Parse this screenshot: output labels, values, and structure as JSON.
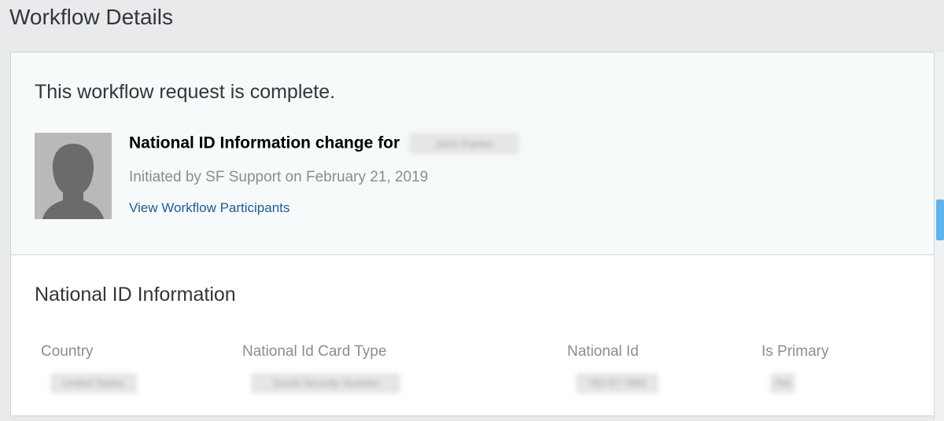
{
  "page": {
    "title": "Workflow Details"
  },
  "summary": {
    "status": "This workflow request is complete.",
    "request_title": "National ID Information change for",
    "subject_name": "John Parker",
    "initiated": "Initiated by SF Support on February 21, 2019",
    "participants_link": "View Workflow Participants"
  },
  "details": {
    "section_title": "National ID Information",
    "columns": [
      {
        "header": "Country",
        "value": "United States"
      },
      {
        "header": "National Id Card Type",
        "value": "Social Security Number"
      },
      {
        "header": "National Id",
        "value": "783-97-7866"
      },
      {
        "header": "Is Primary",
        "value": "Yes"
      }
    ]
  },
  "colors": {
    "link": "#1c5c95",
    "scroll_thumb": "#5fb5ec"
  }
}
